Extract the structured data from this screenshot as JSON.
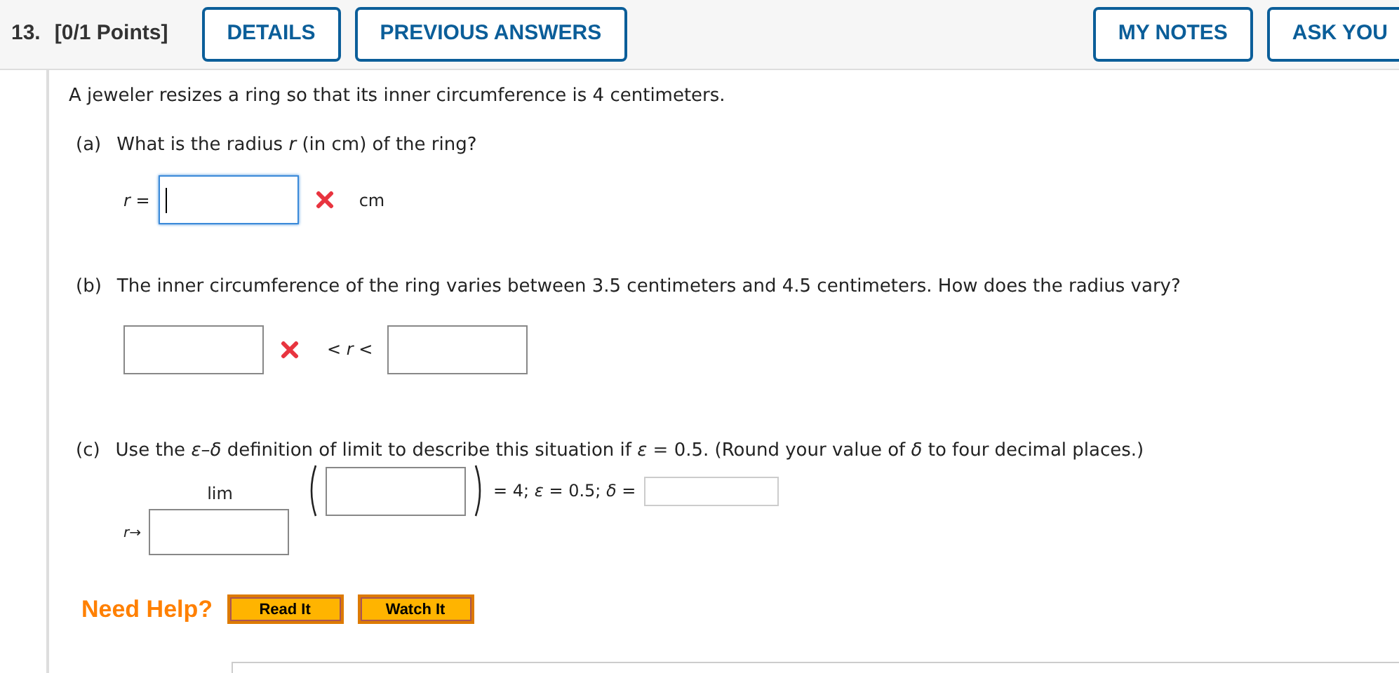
{
  "header": {
    "number": "13.",
    "points": "[0/1 Points]",
    "left_buttons": [
      "DETAILS",
      "PREVIOUS ANSWERS"
    ],
    "right_buttons": [
      "MY NOTES",
      "ASK YOU"
    ]
  },
  "intro": "A jeweler resizes a ring so that its inner circumference is 4 centimeters.",
  "part_a": {
    "label": "(a)",
    "question": "What is the radius *r* (in cm) of the ring?",
    "var": "*r* =",
    "field": {
      "focused": true,
      "incorrect": true
    },
    "unit": "cm"
  },
  "part_b": {
    "label": "(b)",
    "question": "The inner circumference of the ring varies between 3.5 centimeters and 4.5 centimeters. How does the radius vary?",
    "lower": {
      "focused": false,
      "incorrect": true
    },
    "between": "< *r* <",
    "upper": {
      "focused": false,
      "incorrect": false
    }
  },
  "part_c": {
    "label": "(c)",
    "question": "Use the *ε*–*δ* definition of limit to describe this situation if *ε* = 0.5. (Round your value of *δ* to four decimal places.)",
    "lim": "lim",
    "approach": "*r*→",
    "tail": "= 4;  *ε* = 0.5;  *δ* ="
  },
  "help": {
    "label": "Need Help?",
    "buttons": [
      "Read It",
      "Watch It"
    ]
  }
}
